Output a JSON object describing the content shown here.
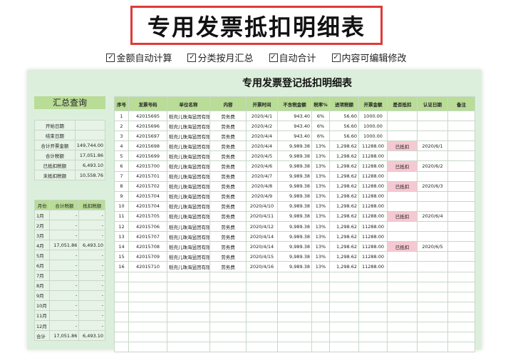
{
  "title": "专用发票抵扣明细表",
  "features": [
    "金额自动计算",
    "分类按月汇总",
    "自动合计",
    "内容可编辑修改"
  ],
  "sheet_title": "专用发票登记抵扣明细表",
  "summary": {
    "heading": "汇总查询",
    "rows": [
      [
        "开始日期",
        ""
      ],
      [
        "结束日期",
        ""
      ],
      [
        "合计开票金额",
        "149,744.00"
      ],
      [
        "合计税额",
        "17,051.86"
      ],
      [
        "已抵扣税额",
        "6,493.10"
      ],
      [
        "未抵扣税额",
        "10,558.76"
      ]
    ]
  },
  "monthly": {
    "headers": [
      "月份",
      "合计税额",
      "抵扣税额"
    ],
    "rows": [
      [
        "1月",
        "-",
        "-"
      ],
      [
        "2月",
        "-",
        "-"
      ],
      [
        "3月",
        "-",
        "-"
      ],
      [
        "4月",
        "17,051.86",
        "6,493.10"
      ],
      [
        "5月",
        "-",
        "-"
      ],
      [
        "6月",
        "-",
        "-"
      ],
      [
        "7月",
        "-",
        "-"
      ],
      [
        "8月",
        "-",
        "-"
      ],
      [
        "9月",
        "-",
        "-"
      ],
      [
        "10月",
        "-",
        "-"
      ],
      [
        "11月",
        "-",
        "-"
      ],
      [
        "12月",
        "-",
        "-"
      ],
      [
        "合计",
        "17,051.86",
        "6,493.10"
      ]
    ]
  },
  "table": {
    "headers": [
      "序号",
      "发票号码",
      "单位名称",
      "内容",
      "开票时间",
      "不含税金额",
      "税率%",
      "进项税额",
      "开票金额",
      "是否抵扣",
      "认证日期",
      "备注"
    ],
    "rows": [
      [
        "1",
        "42015695",
        "稻壳儿珠海昱团有限公司",
        "劳务费",
        "2020/4/1",
        "943.40",
        "6%",
        "56.60",
        "1000.00",
        "",
        "",
        ""
      ],
      [
        "2",
        "42015696",
        "稻壳儿珠海昱团有限公司",
        "劳务费",
        "2020/4/2",
        "943.40",
        "6%",
        "56.60",
        "1000.00",
        "",
        "",
        ""
      ],
      [
        "3",
        "42015697",
        "稻壳儿珠海昱团有限公司",
        "劳务费",
        "2020/4/4",
        "943.40",
        "6%",
        "56.60",
        "1000.00",
        "",
        "",
        ""
      ],
      [
        "4",
        "42015698",
        "稻壳儿珠海昱团有限公司",
        "劳务费",
        "2020/4/4",
        "9,989.38",
        "13%",
        "1,298.62",
        "11288.00",
        "已抵扣",
        "2020/6/1",
        ""
      ],
      [
        "5",
        "42015699",
        "稻壳儿珠海昱团有限公司",
        "劳务费",
        "2020/4/5",
        "9,989.38",
        "13%",
        "1,298.62",
        "11288.00",
        "",
        "",
        ""
      ],
      [
        "6",
        "42015700",
        "稻壳儿珠海昱团有限公司",
        "劳务费",
        "2020/4/6",
        "9,989.38",
        "13%",
        "1,298.62",
        "11288.00",
        "已抵扣",
        "2020/6/2",
        ""
      ],
      [
        "7",
        "42015701",
        "稻壳儿珠海昱团有限公司",
        "劳务费",
        "2020/4/7",
        "9,989.38",
        "13%",
        "1,298.62",
        "11288.00",
        "",
        "",
        ""
      ],
      [
        "8",
        "42015702",
        "稻壳儿珠海昱团有限公司",
        "劳务费",
        "2020/4/8",
        "9,989.38",
        "13%",
        "1,298.62",
        "11288.00",
        "已抵扣",
        "2020/6/3",
        ""
      ],
      [
        "9",
        "42015704",
        "稻壳儿珠海昱团有限公司",
        "劳务费",
        "2020/4/9",
        "9,989.38",
        "13%",
        "1,298.62",
        "11288.00",
        "",
        "",
        ""
      ],
      [
        "10",
        "42015704",
        "稻壳儿珠海昱团有限公司",
        "劳务费",
        "2020/4/10",
        "9,989.38",
        "13%",
        "1,298.62",
        "11288.00",
        "",
        "",
        ""
      ],
      [
        "11",
        "42015705",
        "稻壳儿珠海昱团有限公司",
        "劳务费",
        "2020/4/11",
        "9,989.38",
        "13%",
        "1,298.62",
        "11288.00",
        "已抵扣",
        "2020/6/4",
        ""
      ],
      [
        "12",
        "42015706",
        "稻壳儿珠海昱团有限公司",
        "劳务费",
        "2020/4/12",
        "9,989.38",
        "13%",
        "1,298.62",
        "11288.00",
        "",
        "",
        ""
      ],
      [
        "13",
        "42015707",
        "稻壳儿珠海昱团有限公司",
        "劳务费",
        "2020/4/14",
        "9,989.38",
        "13%",
        "1,298.62",
        "11288.00",
        "",
        "",
        ""
      ],
      [
        "14",
        "42015708",
        "稻壳儿珠海昱团有限公司",
        "劳务费",
        "2020/4/14",
        "9,989.38",
        "13%",
        "1,298.62",
        "11288.00",
        "已抵扣",
        "2020/6/5",
        ""
      ],
      [
        "15",
        "42015709",
        "稻壳儿珠海昱团有限公司",
        "劳务费",
        "2020/4/15",
        "9,989.38",
        "13%",
        "1,298.62",
        "11288.00",
        "",
        "",
        ""
      ],
      [
        "16",
        "42015710",
        "稻壳儿珠海昱团有限公司",
        "劳务费",
        "2020/4/16",
        "9,989.38",
        "13%",
        "1,298.62",
        "11288.00",
        "",
        "",
        ""
      ]
    ]
  },
  "colors": {
    "header_green": "#b9dc96",
    "deducted_pink": "#f6c9d2",
    "title_border": "#e03a3a"
  }
}
